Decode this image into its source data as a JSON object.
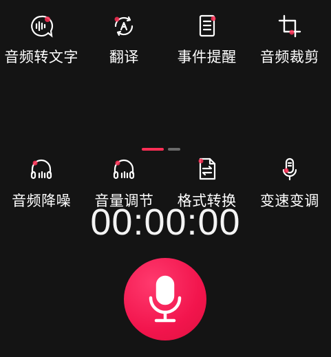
{
  "tools_row1": [
    {
      "label": "音频转文字",
      "icon": "audio-to-text-icon"
    },
    {
      "label": "翻译",
      "icon": "translate-icon"
    },
    {
      "label": "事件提醒",
      "icon": "event-reminder-icon"
    },
    {
      "label": "音频裁剪",
      "icon": "crop-icon"
    }
  ],
  "tools_row2": [
    {
      "label": "音频降噪",
      "icon": "headphones-icon"
    },
    {
      "label": "音量调节",
      "icon": "headphones-icon"
    },
    {
      "label": "格式转换",
      "icon": "format-convert-icon"
    },
    {
      "label": "变速变调",
      "icon": "microphone-icon"
    }
  ],
  "pager": {
    "active_index": 0,
    "count": 2
  },
  "timer": "00:00:00",
  "colors": {
    "background": "#141414",
    "accent": "#ff2f55",
    "text": "#ffffff"
  }
}
